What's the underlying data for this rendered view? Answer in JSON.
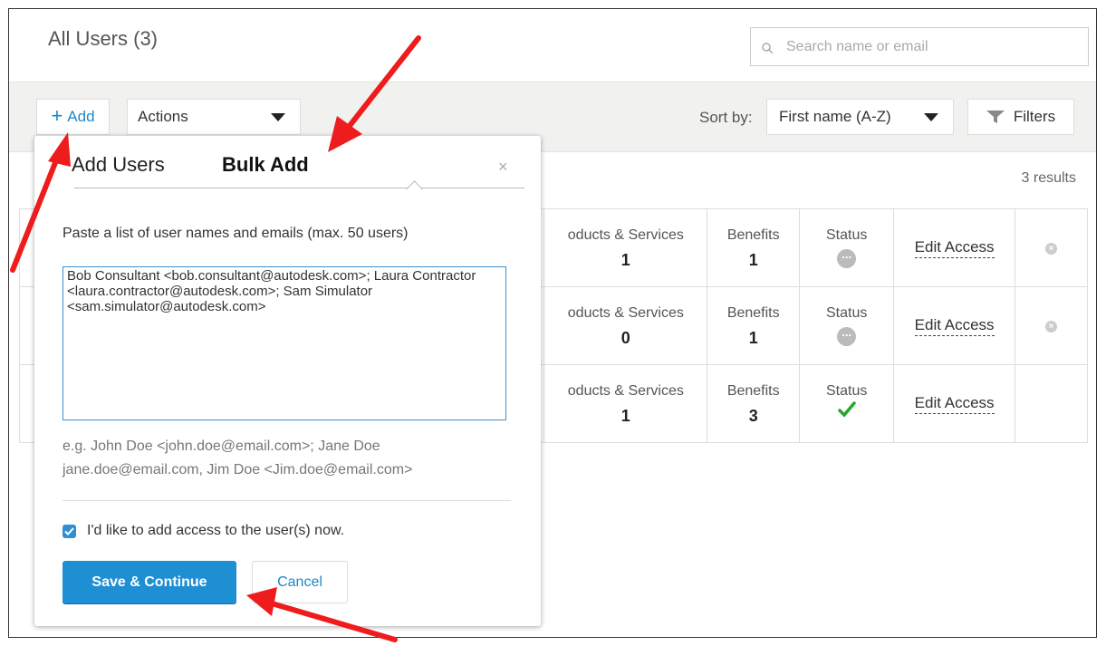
{
  "page": {
    "title": "All Users (3)"
  },
  "search": {
    "placeholder": "Search name or email"
  },
  "toolbar": {
    "add_label": "Add",
    "actions_label": "Actions",
    "sort_by_label": "Sort by:",
    "sort_value": "First name (A-Z)",
    "filters_label": "Filters"
  },
  "results": {
    "count_text": "3 results"
  },
  "table": {
    "rows": [
      {
        "products_label": "oducts & Services",
        "products_count": "1",
        "benefits_label": "Benefits",
        "benefits_count": "1",
        "status_label": "Status",
        "status": "pending",
        "edit_label": "Edit Access",
        "removable": true
      },
      {
        "products_label": "oducts & Services",
        "products_count": "0",
        "benefits_label": "Benefits",
        "benefits_count": "1",
        "status_label": "Status",
        "status": "pending",
        "edit_label": "Edit Access",
        "removable": true
      },
      {
        "products_label": "oducts & Services",
        "products_count": "1",
        "benefits_label": "Benefits",
        "benefits_count": "3",
        "status_label": "Status",
        "status": "active",
        "edit_label": "Edit Access",
        "removable": false
      }
    ]
  },
  "modal": {
    "tab_add": "Add Users",
    "tab_bulk": "Bulk Add",
    "close": "×",
    "instruction": "Paste a list of user names and emails (max. 50 users)",
    "bulk_text": "Bob Consultant <bob.consultant@autodesk.com>; Laura Contractor <laura.contractor@autodesk.com>; Sam Simulator <sam.simulator@autodesk.com>",
    "example_line1": "e.g. John Doe <john.doe@email.com>; Jane Doe",
    "example_line2": "jane.doe@email.com, Jim Doe <Jim.doe@email.com>",
    "checkbox_label": "I'd like to add access to the user(s) now.",
    "checkbox_checked": true,
    "save_label": "Save & Continue",
    "cancel_label": "Cancel"
  },
  "colors": {
    "accent": "#1f8fd4",
    "link": "#1e88c7",
    "annotation_arrow": "#ee1c1c",
    "success": "#2aa52a",
    "toolbar_bg": "#f1f1ef"
  }
}
